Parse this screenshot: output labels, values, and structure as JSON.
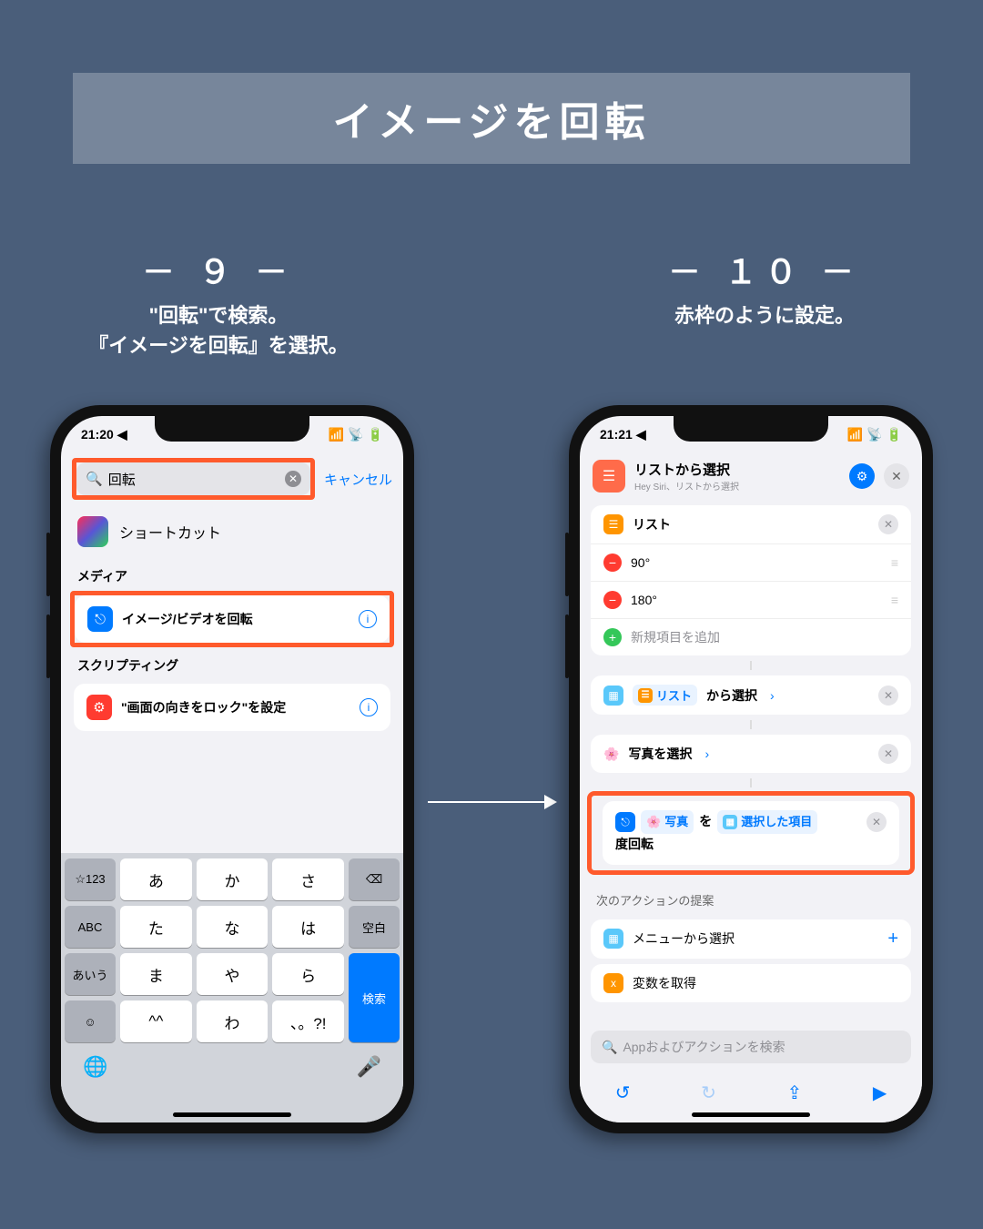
{
  "title": "イメージを回転",
  "steps": {
    "left": {
      "number": "－ ９ －",
      "caption_line1": "\"回転\"で検索。",
      "caption_line2": "『イメージを回転』を選択。"
    },
    "right": {
      "number": "－ １０ －",
      "caption": "赤枠のように設定。"
    }
  },
  "phone_left": {
    "status_time": "21:20",
    "search_query": "回転",
    "cancel": "キャンセル",
    "shortcuts_label": "ショートカット",
    "section_media": "メディア",
    "action_rotate": "イメージ/ビデオを回転",
    "section_scripting": "スクリプティング",
    "action_orientation": "\"画面の向きをロック\"を設定",
    "keyboard": {
      "row1": [
        "☆123",
        "あ",
        "か",
        "さ",
        "⌫"
      ],
      "row2": [
        "ABC",
        "た",
        "な",
        "は",
        "空白"
      ],
      "row3": [
        "あいう",
        "ま",
        "や",
        "ら",
        "検索"
      ],
      "row4": [
        "☺",
        "^^",
        "わ",
        "、。?!",
        ""
      ]
    }
  },
  "phone_right": {
    "status_time": "21:21",
    "header_title": "リストから選択",
    "header_sub": "Hey Siri、リストから選択",
    "list_label": "リスト",
    "list_items": [
      "90°",
      "180°"
    ],
    "add_item": "新規項目を追加",
    "choose_from_list_pre": "リスト",
    "choose_from_list_post": "から選択",
    "select_photos": "写真を選択",
    "rotate_prefix": "写真",
    "rotate_mid": "を",
    "rotate_selected": "選択した項目",
    "rotate_suffix": "度回転",
    "suggestion_header": "次のアクションの提案",
    "suggestion_menu": "メニューから選択",
    "suggestion_var": "変数を取得",
    "search_placeholder": "Appおよびアクションを検索"
  }
}
